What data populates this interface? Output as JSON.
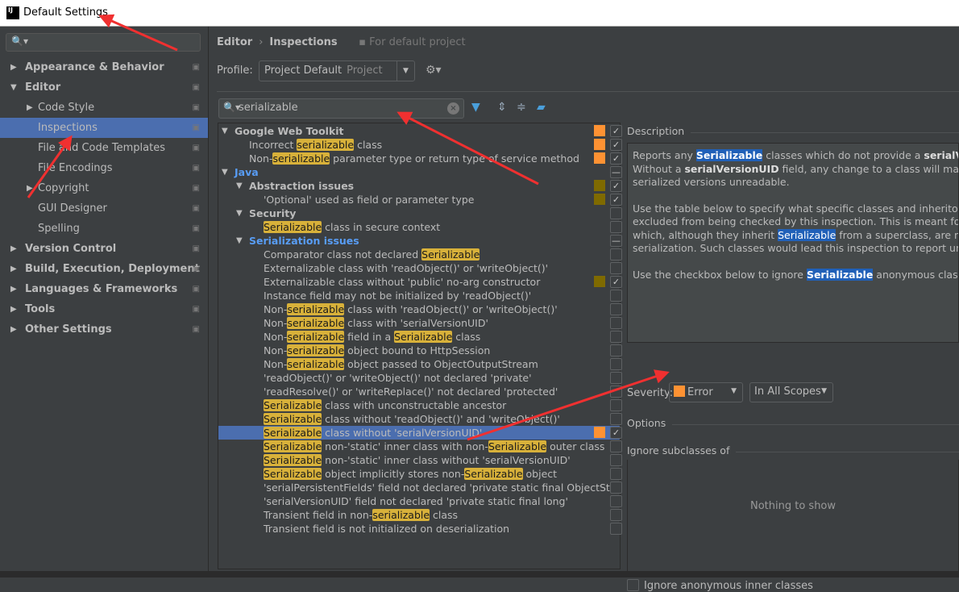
{
  "window": {
    "title": "Default Settings",
    "logo": "IJ"
  },
  "sidebar": {
    "search_placeholder": "",
    "items": [
      {
        "label": "Appearance & Behavior",
        "level": 0,
        "arrow": "right",
        "bold": true
      },
      {
        "label": "Editor",
        "level": 0,
        "arrow": "down",
        "bold": true
      },
      {
        "label": "Code Style",
        "level": 1,
        "arrow": "right"
      },
      {
        "label": "Inspections",
        "level": 1,
        "selected": true
      },
      {
        "label": "File and Code Templates",
        "level": 1
      },
      {
        "label": "File Encodings",
        "level": 1
      },
      {
        "label": "Copyright",
        "level": 1,
        "arrow": "right"
      },
      {
        "label": "GUI Designer",
        "level": 1
      },
      {
        "label": "Spelling",
        "level": 1
      },
      {
        "label": "Version Control",
        "level": 0,
        "arrow": "right",
        "bold": true
      },
      {
        "label": "Build, Execution, Deployment",
        "level": 0,
        "arrow": "right",
        "bold": true
      },
      {
        "label": "Languages & Frameworks",
        "level": 0,
        "arrow": "right",
        "bold": true
      },
      {
        "label": "Tools",
        "level": 0,
        "arrow": "right",
        "bold": true
      },
      {
        "label": "Other Settings",
        "level": 0,
        "arrow": "right",
        "bold": true
      }
    ]
  },
  "breadcrumb": {
    "parent": "Editor",
    "separator": "›",
    "current": "Inspections",
    "scope_note": "For default project"
  },
  "profile": {
    "label": "Profile:",
    "value": "Project Default",
    "sub": "Project"
  },
  "search": {
    "value": "serializable"
  },
  "colors": {
    "error": "#fe9233",
    "warning": "#7f6a00",
    "selection": "#4b6eaf",
    "highlight": "#d8b13a",
    "accent": "#589df6"
  },
  "tree": [
    {
      "level": 0,
      "group": true,
      "bold": true,
      "segs": [
        [
          "Google Web Toolkit",
          0
        ]
      ],
      "sev": "error",
      "check": "on"
    },
    {
      "level": 2,
      "segs": [
        [
          "Incorrect ",
          0
        ],
        [
          "serializable",
          1
        ],
        [
          " class",
          0
        ]
      ],
      "sev": "error",
      "check": "on"
    },
    {
      "level": 2,
      "segs": [
        [
          "Non-",
          0
        ],
        [
          "serializable",
          1
        ],
        [
          " parameter type or return type of service method",
          0
        ]
      ],
      "sev": "error",
      "check": "on"
    },
    {
      "level": 0,
      "group": true,
      "bold": true,
      "blue": true,
      "segs": [
        [
          "Java",
          0
        ]
      ],
      "check": "mixed"
    },
    {
      "level": 1,
      "group": true,
      "bold": true,
      "segs": [
        [
          "Abstraction issues",
          0
        ]
      ],
      "sev": "warning",
      "check": "on"
    },
    {
      "level": 3,
      "segs": [
        [
          "'Optional' used as field or parameter type",
          0
        ]
      ],
      "sev": "warning",
      "check": "on"
    },
    {
      "level": 1,
      "group": true,
      "bold": true,
      "segs": [
        [
          "Security",
          0
        ]
      ],
      "check": "off"
    },
    {
      "level": 3,
      "segs": [
        [
          "Serializable",
          1
        ],
        [
          " class in secure context",
          0
        ]
      ],
      "check": "off"
    },
    {
      "level": 1,
      "group": true,
      "bold": true,
      "blue": true,
      "segs": [
        [
          "Serialization issues",
          0
        ]
      ],
      "check": "mixed"
    },
    {
      "level": 3,
      "segs": [
        [
          "Comparator class not declared ",
          0
        ],
        [
          "Serializable",
          1
        ]
      ],
      "check": "off"
    },
    {
      "level": 3,
      "segs": [
        [
          "Externalizable class with 'readObject()' or 'writeObject()'",
          0
        ]
      ],
      "check": "off"
    },
    {
      "level": 3,
      "segs": [
        [
          "Externalizable class without 'public' no-arg constructor",
          0
        ]
      ],
      "sev": "warning",
      "check": "on"
    },
    {
      "level": 3,
      "segs": [
        [
          "Instance field may not be initialized by 'readObject()'",
          0
        ]
      ],
      "check": "off"
    },
    {
      "level": 3,
      "segs": [
        [
          "Non-",
          0
        ],
        [
          "serializable",
          1
        ],
        [
          " class with 'readObject()' or 'writeObject()'",
          0
        ]
      ],
      "check": "off"
    },
    {
      "level": 3,
      "segs": [
        [
          "Non-",
          0
        ],
        [
          "serializable",
          1
        ],
        [
          " class with 'serialVersionUID'",
          0
        ]
      ],
      "check": "off"
    },
    {
      "level": 3,
      "segs": [
        [
          "Non-",
          0
        ],
        [
          "serializable",
          1
        ],
        [
          " field in a ",
          0
        ],
        [
          "Serializable",
          1
        ],
        [
          " class",
          0
        ]
      ],
      "check": "off"
    },
    {
      "level": 3,
      "segs": [
        [
          "Non-",
          0
        ],
        [
          "serializable",
          1
        ],
        [
          " object bound to HttpSession",
          0
        ]
      ],
      "check": "off"
    },
    {
      "level": 3,
      "segs": [
        [
          "Non-",
          0
        ],
        [
          "serializable",
          1
        ],
        [
          " object passed to ObjectOutputStream",
          0
        ]
      ],
      "check": "off"
    },
    {
      "level": 3,
      "segs": [
        [
          "'readObject()' or 'writeObject()' not declared 'private'",
          0
        ]
      ],
      "check": "off"
    },
    {
      "level": 3,
      "segs": [
        [
          "'readResolve()' or 'writeReplace()' not declared 'protected'",
          0
        ]
      ],
      "check": "off"
    },
    {
      "level": 3,
      "segs": [
        [
          "Serializable",
          1
        ],
        [
          " class with unconstructable ancestor",
          0
        ]
      ],
      "check": "off"
    },
    {
      "level": 3,
      "segs": [
        [
          "Serializable",
          1
        ],
        [
          " class without 'readObject()' and 'writeObject()'",
          0
        ]
      ],
      "check": "off"
    },
    {
      "level": 3,
      "selected": true,
      "segs": [
        [
          "Serializable",
          1
        ],
        [
          " class without 'serialVersionUID'",
          0
        ]
      ],
      "sev": "error",
      "check": "on"
    },
    {
      "level": 3,
      "segs": [
        [
          "Serializable",
          1
        ],
        [
          " non-'static' inner class with non-",
          0
        ],
        [
          "Serializable",
          1
        ],
        [
          " outer class",
          0
        ]
      ],
      "check": "off"
    },
    {
      "level": 3,
      "segs": [
        [
          "Serializable",
          1
        ],
        [
          " non-'static' inner class without 'serialVersionUID'",
          0
        ]
      ],
      "check": "off"
    },
    {
      "level": 3,
      "segs": [
        [
          "Serializable",
          1
        ],
        [
          " object implicitly stores non-",
          0
        ],
        [
          "Serializable",
          1
        ],
        [
          " object",
          0
        ]
      ],
      "check": "off"
    },
    {
      "level": 3,
      "segs": [
        [
          "'serialPersistentFields' field not declared 'private static final ObjectStre",
          0
        ]
      ],
      "check": "off"
    },
    {
      "level": 3,
      "segs": [
        [
          "'serialVersionUID' field not declared 'private static final long'",
          0
        ]
      ],
      "check": "off"
    },
    {
      "level": 3,
      "segs": [
        [
          "Transient field in non-",
          0
        ],
        [
          "serializable",
          1
        ],
        [
          " class",
          0
        ]
      ],
      "check": "off"
    },
    {
      "level": 3,
      "segs": [
        [
          "Transient field is not initialized on deserialization",
          0
        ]
      ],
      "check": "off"
    }
  ],
  "description": {
    "title": "Description",
    "p1": {
      "a": "Reports any ",
      "kw": "Serializable",
      "b": " classes which do not provide a ",
      "bold1": "serialVersio",
      "line2a": "Without a ",
      "bold2": "serialVersionUID",
      "line2b": " field, any change to a class will make pre",
      "line3": "serialized versions unreadable."
    },
    "p2": {
      "l1": "Use the table below to specify what specific classes and inheritors sho",
      "l2": "excluded from being checked by this inspection. This is meant for tho",
      "l3a": "which, although they inherit ",
      "kw": "Serializable",
      "l3b": " from a superclass, are not int",
      "l4": "serialization. Such classes would lead this inspection to report unnece"
    },
    "p3": {
      "a": "Use the checkbox below to ignore ",
      "kw": "Serializable",
      "b": " anonymous classes."
    }
  },
  "severity": {
    "label": "Severity:",
    "value": "Error",
    "scope": "In All Scopes"
  },
  "options": {
    "title": "Options",
    "subclasses_title": "Ignore subclasses of",
    "empty": "Nothing to show",
    "ignore_anon_label": "Ignore anonymous inner classes",
    "ignore_anon_checked": false
  }
}
